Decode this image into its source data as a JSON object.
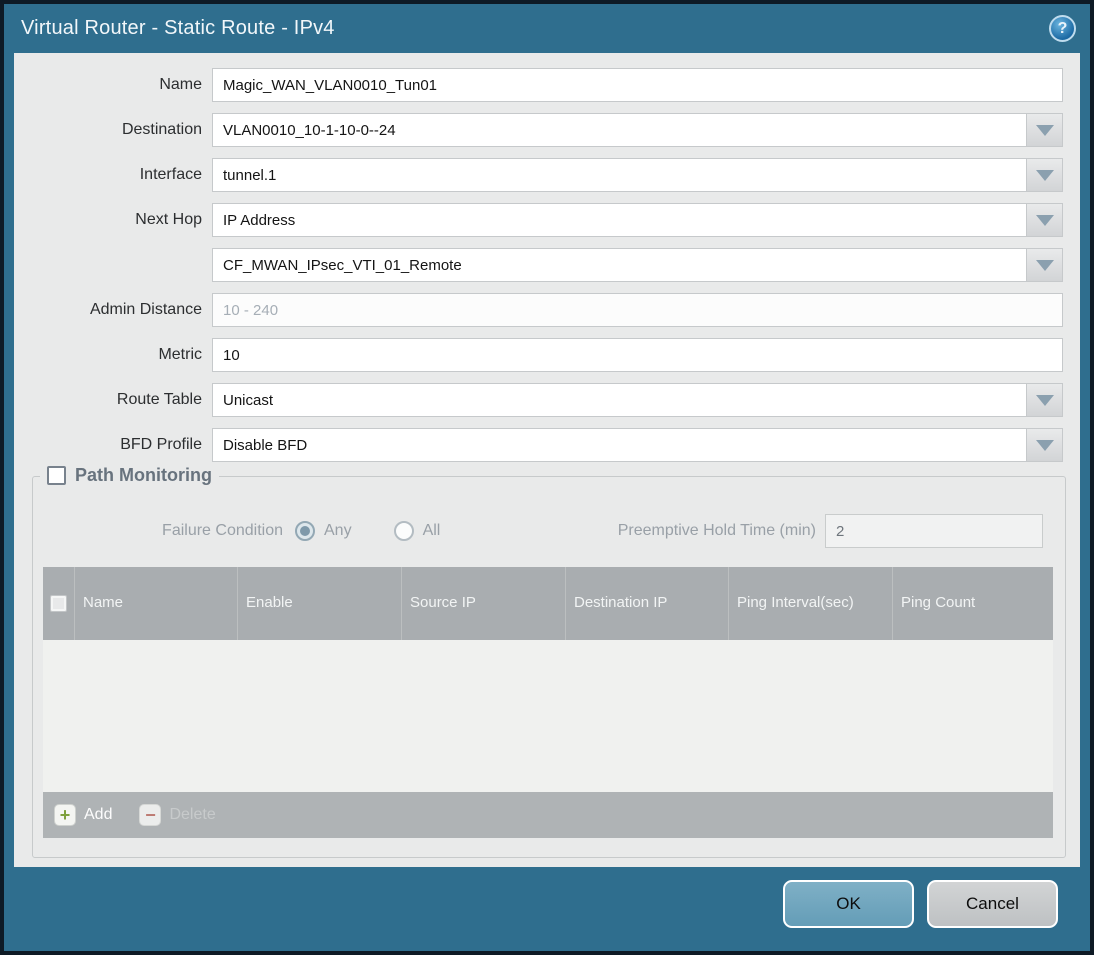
{
  "title": "Virtual Router - Static Route - IPv4",
  "help_icon": "?",
  "form": {
    "name": {
      "label": "Name",
      "value": "Magic_WAN_VLAN0010_Tun01"
    },
    "destination": {
      "label": "Destination",
      "value": "VLAN0010_10-1-10-0--24"
    },
    "interface": {
      "label": "Interface",
      "value": "tunnel.1"
    },
    "next_hop": {
      "label": "Next Hop",
      "value": "IP Address"
    },
    "next_hop_address": {
      "value": "CF_MWAN_IPsec_VTI_01_Remote"
    },
    "admin_distance": {
      "label": "Admin Distance",
      "placeholder": "10 - 240",
      "value": ""
    },
    "metric": {
      "label": "Metric",
      "value": "10"
    },
    "route_table": {
      "label": "Route Table",
      "value": "Unicast"
    },
    "bfd_profile": {
      "label": "BFD Profile",
      "value": "Disable BFD"
    }
  },
  "path_monitoring": {
    "legend": "Path Monitoring",
    "enabled": false,
    "failure_condition": {
      "label": "Failure Condition",
      "any_label": "Any",
      "all_label": "All",
      "selected": "Any"
    },
    "preemptive_hold_time": {
      "label": "Preemptive Hold Time (min)",
      "value": "2"
    },
    "table": {
      "columns": [
        "Name",
        "Enable",
        "Source IP",
        "Destination IP",
        "Ping Interval(sec)",
        "Ping Count"
      ],
      "rows": [],
      "add_label": "Add",
      "delete_label": "Delete"
    }
  },
  "footer": {
    "ok_label": "OK",
    "cancel_label": "Cancel"
  },
  "colors": {
    "frame_teal": "#2f6e8e",
    "outer_border": "#0e1a25",
    "content_bg": "#e9eaea",
    "table_header_bg": "#a9adb0",
    "ok_button_bg": "#6fa4bc",
    "cancel_button_bg": "#c6c9cb",
    "add_plus_green": "#7da03c",
    "delete_minus_red": "#bd7b72"
  }
}
